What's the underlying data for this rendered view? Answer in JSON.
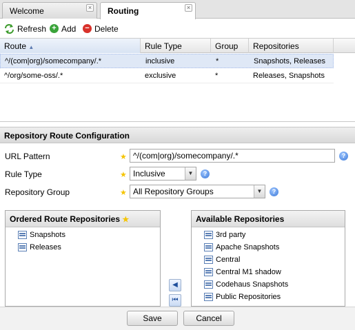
{
  "tabs": [
    {
      "label": "Welcome",
      "active": false
    },
    {
      "label": "Routing",
      "active": true
    }
  ],
  "toolbar": {
    "refresh_label": "Refresh",
    "add_label": "Add",
    "delete_label": "Delete"
  },
  "grid": {
    "columns": [
      "Route",
      "Rule Type",
      "Group",
      "Repositories"
    ],
    "sort_indicator": "▲",
    "rows": [
      {
        "route": "^/(com|org)/somecompany/.*",
        "rule_type": "inclusive",
        "group": "*",
        "repositories": "Snapshots, Releases",
        "selected": true
      },
      {
        "route": "^/org/some-oss/.*",
        "rule_type": "exclusive",
        "group": "*",
        "repositories": "Releases, Snapshots",
        "selected": false
      }
    ]
  },
  "config": {
    "title": "Repository Route Configuration",
    "url_pattern_label": "URL Pattern",
    "url_pattern_value": "^/(com|org)/somecompany/.*",
    "rule_type_label": "Rule Type",
    "rule_type_value": "Inclusive",
    "repo_group_label": "Repository Group",
    "repo_group_value": "All Repository Groups",
    "required_marker": "★",
    "help_glyph": "?"
  },
  "ordered": {
    "title": "Ordered Route Repositories",
    "items": [
      "Snapshots",
      "Releases"
    ]
  },
  "available": {
    "title": "Available Repositories",
    "items": [
      "3rd party",
      "Apache Snapshots",
      "Central",
      "Central M1 shadow",
      "Codehaus Snapshots",
      "Public Repositories"
    ]
  },
  "buttons": {
    "save_label": "Save",
    "cancel_label": "Cancel",
    "move_left": "◀",
    "move_all_left": "⏮"
  },
  "colors": {
    "selected_row": "#dfe8f6",
    "refresh_green": "#3a9a2a",
    "add_green": "#3aa33a",
    "delete_red": "#d8322b",
    "required_star": "#f5c400"
  }
}
